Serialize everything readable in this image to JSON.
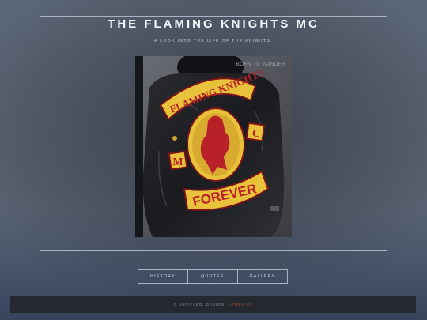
{
  "header": {
    "title": "THE FLAMING KNIGHTS MC",
    "subtitle": "A LOOK INTO THE LIFE OF THE KNIGHTS."
  },
  "photo": {
    "caption": "BORN TO WANDER",
    "patch_top_rocker": "FLAMING KNIGHTS",
    "patch_bottom_rocker": "FOREVER",
    "patch_left": "M",
    "patch_right": "C"
  },
  "nav": {
    "items": [
      {
        "label": "HISTORY"
      },
      {
        "label": "QUOTES"
      },
      {
        "label": "GALLERY"
      }
    ]
  },
  "footer": {
    "copyright": "© UNTITLED. DESIGN:",
    "credit": "HTML5 UP"
  },
  "colors": {
    "patch_yellow": "#e8c23a",
    "patch_red": "#b8202a",
    "accent_link": "#b0543c"
  }
}
